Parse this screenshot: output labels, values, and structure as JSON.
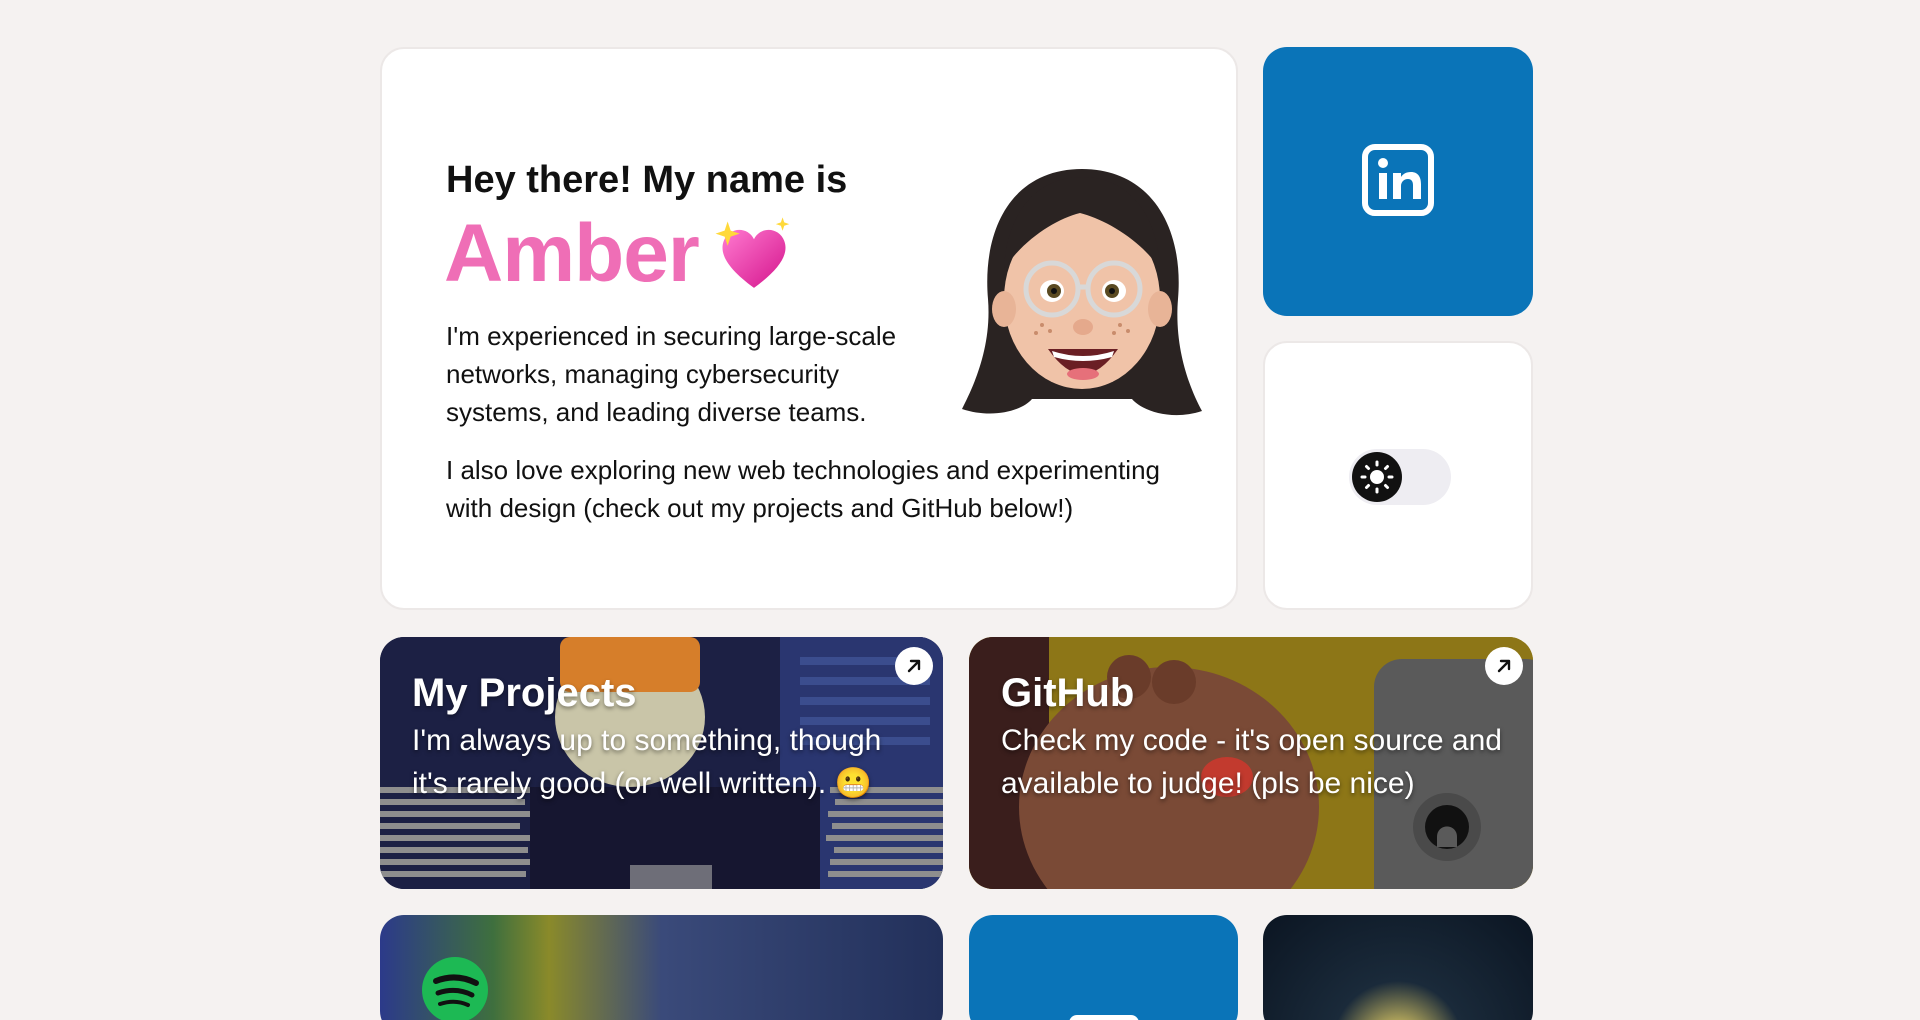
{
  "intro": {
    "greeting": "Hey there! My name is",
    "name": "Amber",
    "bio_primary": "I'm experienced in securing large-scale networks, managing cybersecurity systems, and leading diverse teams.",
    "bio_secondary": "I also love exploring new web technologies and experimenting with design (check out my projects and GitHub below!)"
  },
  "linkedin": {
    "icon": "linkedin-icon",
    "color": "#0a74b8"
  },
  "theme_toggle": {
    "icon": "sun-icon",
    "state": "light"
  },
  "projects": {
    "title": "My Projects",
    "description": "I'm always up to something, though it's rarely good (or well written). 😬"
  },
  "github": {
    "title": "GitHub",
    "description": "Check my code - it's open source and available to judge! (pls be nice)"
  },
  "bottom_row": {
    "spotify": {
      "icon": "spotify-icon",
      "color": "#1db954"
    }
  },
  "colors": {
    "background": "#f5f2f1",
    "accent_pink": "#ef6eb6"
  }
}
